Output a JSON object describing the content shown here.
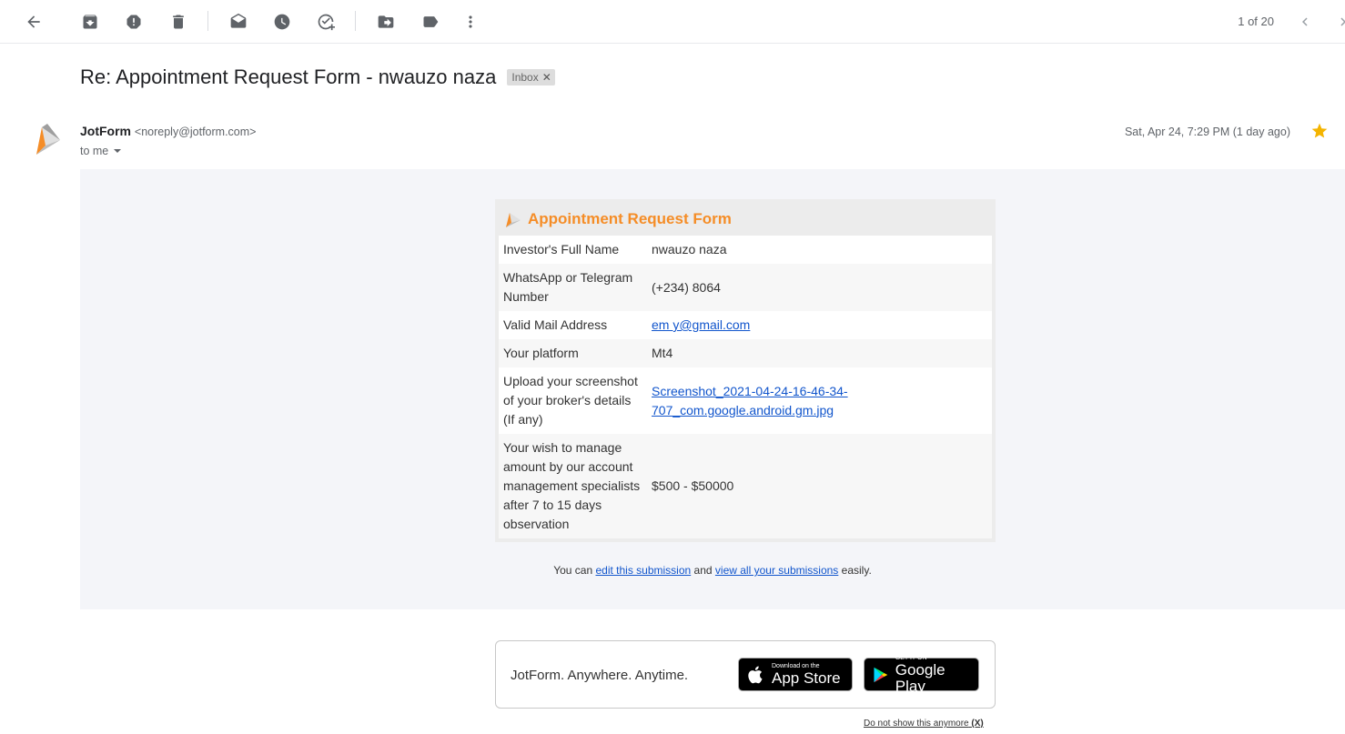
{
  "toolbar": {
    "icons": [
      "back-arrow-icon",
      "archive-icon",
      "report-spam-icon",
      "delete-icon",
      "mark-unread-icon",
      "snooze-icon",
      "add-task-icon",
      "move-to-icon",
      "label-icon",
      "more-icon"
    ],
    "pager": "1 of 20"
  },
  "email": {
    "subject": "Re: Appointment Request Form - nwauzo      naza",
    "label_chip": "Inbox",
    "sender_name": "JotForm",
    "sender_email": "<noreply@jotform.com>",
    "to": "to me",
    "date": "Sat, Apr 24, 7:29 PM (1 day ago)"
  },
  "form": {
    "title": "Appointment Request Form",
    "rows": [
      {
        "question": "Investor's Full Name",
        "answer": "nwauzo      naza"
      },
      {
        "question": "WhatsApp or Telegram Number",
        "answer": "(+234) 8064"
      },
      {
        "question": "Valid Mail Address",
        "answer": "em       y@gmail.com"
      },
      {
        "question": "Your platform",
        "answer": "Mt4"
      },
      {
        "question": "Upload your screenshot of your broker's details (If any)",
        "answer": "Screenshot_2021-04-24-16-46-34-707_com.google.android.gm.jpg"
      },
      {
        "question": "Your wish to manage amount by our account management specialists after 7 to 15 days observation",
        "answer": "$500 - $50000"
      }
    ],
    "footer_prefix": "You can",
    "edit_link": "edit this submission",
    "footer_mid": "and",
    "view_link": "view all your submissions",
    "footer_suffix": "easily."
  },
  "promo": {
    "tagline": "JotForm. Anywhere. Anytime.",
    "appstore_small": "Download on the",
    "appstore_big": "App Store",
    "googleplay_small": "GET IT ON",
    "googleplay_big": "Google Play",
    "dont_show": "Do not show this anymore",
    "dont_show_x": "(X)"
  },
  "colors": {
    "form_title": "#f58d27",
    "link": "#1155cc",
    "star": "#f4b400"
  }
}
